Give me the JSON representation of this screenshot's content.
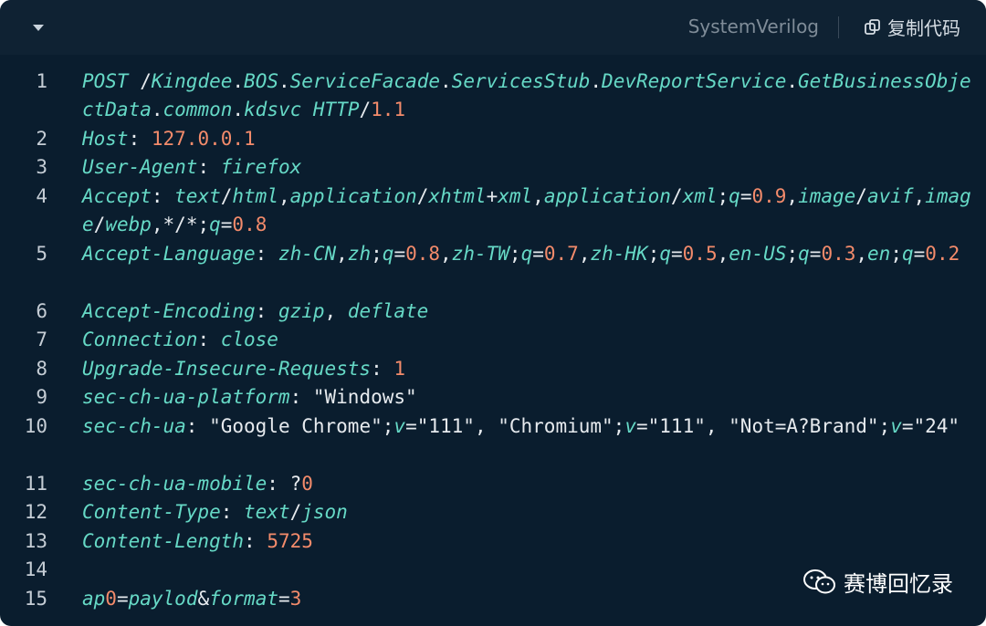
{
  "toolbar": {
    "language": "SystemVerilog",
    "copy_label": "复制代码"
  },
  "watermark": {
    "label": "赛博回忆录"
  },
  "colors": {
    "background": "#0a1d2e",
    "keyword": "#66d9c6",
    "number": "#f38b6b",
    "text": "#e6eaee"
  },
  "lines": [
    {
      "n": "1",
      "text": "POST /Kingdee.BOS.ServiceFacade.ServicesStub.DevReportService.GetBusinessObjectData.common.kdsvc HTTP/1.1"
    },
    {
      "n": "2",
      "text": "Host: 127.0.0.1"
    },
    {
      "n": "3",
      "text": "User-Agent: firefox"
    },
    {
      "n": "4",
      "text": "Accept: text/html,application/xhtml+xml,application/xml;q=0.9,image/avif,image/webp,*/*;q=0.8"
    },
    {
      "n": "5",
      "text": "Accept-Language: zh-CN,zh;q=0.8,zh-TW;q=0.7,zh-HK;q=0.5,en-US;q=0.3,en;q=0.2"
    },
    {
      "n": "6",
      "text": "Accept-Encoding: gzip, deflate"
    },
    {
      "n": "7",
      "text": "Connection: close"
    },
    {
      "n": "8",
      "text": "Upgrade-Insecure-Requests: 1"
    },
    {
      "n": "9",
      "text": "sec-ch-ua-platform: \"Windows\""
    },
    {
      "n": "10",
      "text": "sec-ch-ua: \"Google Chrome\";v=\"111\", \"Chromium\";v=\"111\", \"Not=A?Brand\";v=\"24\""
    },
    {
      "n": "11",
      "text": "sec-ch-ua-mobile: ?0"
    },
    {
      "n": "12",
      "text": "Content-Type: text/json"
    },
    {
      "n": "13",
      "text": "Content-Length: 5725"
    },
    {
      "n": "14",
      "text": ""
    },
    {
      "n": "15",
      "text": "ap0=paylod&format=3"
    }
  ]
}
